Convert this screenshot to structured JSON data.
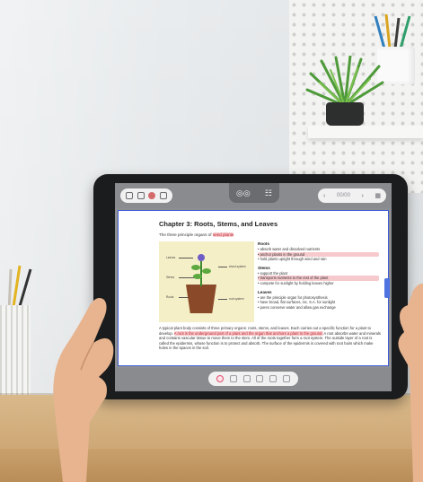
{
  "toolbar": {
    "left_icons": [
      "grid-icon",
      "save-icon",
      "record-icon",
      "pen-icon"
    ],
    "center_icons": [
      "glasses-icon",
      "book-icon"
    ],
    "right": {
      "prev": "‹",
      "page_label": "00/00",
      "next": "›",
      "end_icon": "grid-icon"
    }
  },
  "document": {
    "title": "Chapter 3: Roots, Stems, and Leaves",
    "subtitle_prefix": "The three principle organs of ",
    "subtitle_highlight": "seed plants",
    "figure_labels": {
      "leaves": "Leaves",
      "stems": "Stems",
      "roots": "Roots",
      "shoot_system": "shoot system",
      "root_system": "root system"
    },
    "notes": [
      {
        "heading": "Roots",
        "items": [
          {
            "text": "• absorb water and dissolved nutrients",
            "highlight": false
          },
          {
            "text": "• anchor plants in the ground",
            "highlight": true
          },
          {
            "text": "• hold plants upright through wind and rain",
            "highlight": false
          }
        ]
      },
      {
        "heading": "Stems",
        "items": [
          {
            "text": "• support the plant",
            "highlight": false
          },
          {
            "text": "• transports nutrients to the rest of the plant",
            "highlight": true
          },
          {
            "text": "• compete for sunlight by holding leaves higher",
            "highlight": false
          }
        ]
      },
      {
        "heading": "Leaves",
        "items": [
          {
            "text": "• are the principle organ for photosynthesis",
            "highlight": false
          },
          {
            "text": "• have broad, flat surfaces, inc. S.A. for sunlight",
            "highlight": false
          },
          {
            "text": "• pores conserve water and allow gas exchange",
            "highlight": false
          }
        ]
      }
    ],
    "paragraph": {
      "part1": "A typical plant body consists of three primary organs: roots, stems, and leaves.  Each carries out a specific function for a plant to develop.  ",
      "highlight": "A root is the underground part of a plant and the organ that anchors a plant to the ground.",
      "part2": "  A root absorbs water and minerals and contains vascular tissue to move them to the stem.  All of the roots together form a root system.  The outside layer of a root is called the epidermis, whose function is to protect and absorb.  The surface of the epidermis is covered with root hairs which make holes in the spaces in the soil."
    }
  },
  "bottombar": {
    "tools": [
      "lasso-icon",
      "pen-icon",
      "highlighter-icon",
      "text-icon",
      "shape-icon",
      "eraser-icon"
    ],
    "active_tool": "lasso-icon"
  },
  "colors": {
    "accent": "#3e5bd8",
    "highlight": "#f6c9cc",
    "highlight_text": "#c0262d",
    "bezel": "#1b1c1e",
    "toolbar": "#8a8b8e"
  }
}
